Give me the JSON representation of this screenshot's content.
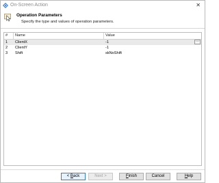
{
  "window": {
    "title": "On-Screen Action",
    "close_glyph": "✕"
  },
  "header": {
    "title": "Operation Parameters",
    "subtitle": "Specify the type and values of operation parameters."
  },
  "table": {
    "columns": [
      "#",
      "Name",
      "Value"
    ],
    "rows": [
      {
        "num": "1",
        "name": "ClientX",
        "value": "-1"
      },
      {
        "num": "2",
        "name": "ClientY",
        "value": "-1"
      },
      {
        "num": "3",
        "name": "Shift",
        "value": "skNoShift"
      }
    ],
    "ellipsis": "···"
  },
  "buttons": {
    "back": {
      "prefix": "< ",
      "mnemonic": "B",
      "rest": "ack"
    },
    "next": {
      "label": "Next >"
    },
    "finish": {
      "mnemonic": "F",
      "rest": "inish"
    },
    "cancel": {
      "label": "Cancel"
    },
    "help": {
      "mnemonic": "H",
      "rest": "elp"
    }
  }
}
